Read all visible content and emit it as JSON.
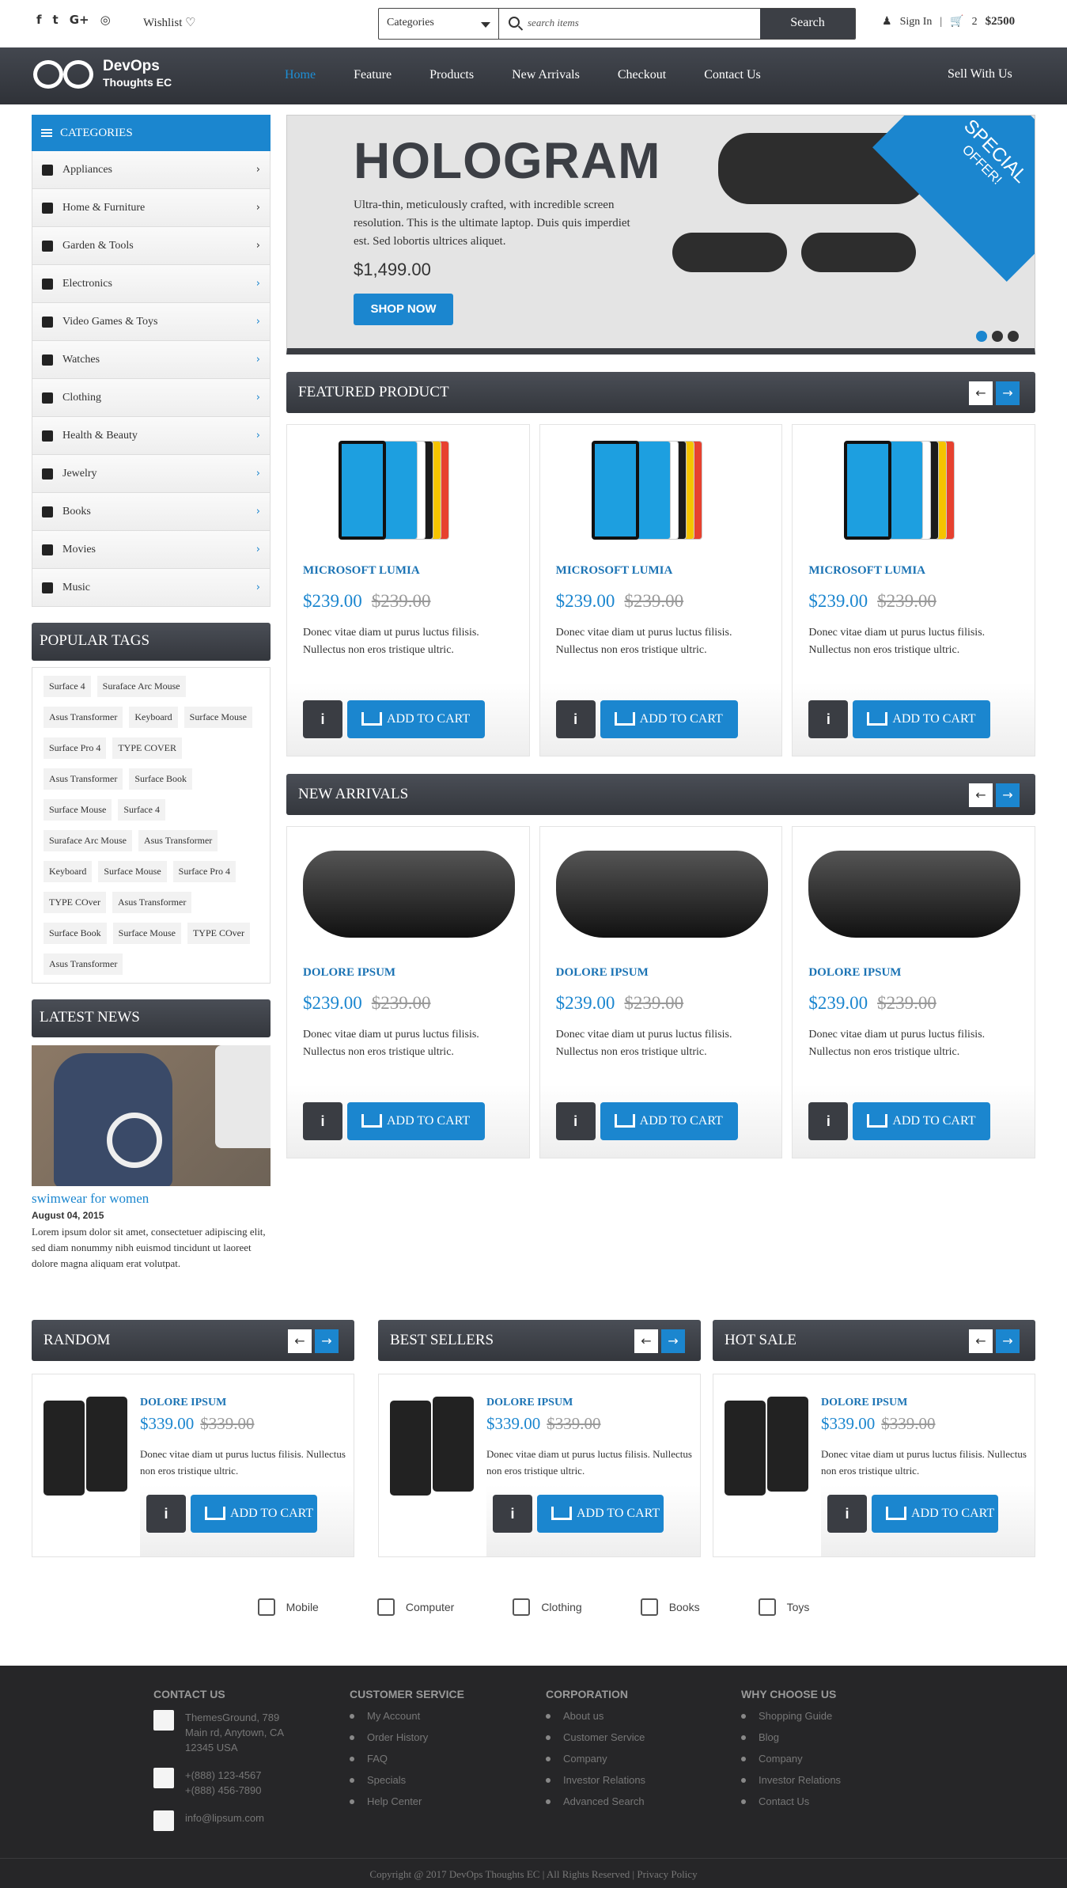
{
  "topbar": {
    "social_icons": [
      "facebook-icon",
      "twitter-icon",
      "google-plus-icon",
      "instagram-icon"
    ],
    "social_glyphs": [
      "f",
      "t",
      "G+",
      "◎"
    ],
    "wishlist": "Wishlist ♡",
    "search": {
      "category": "Categories",
      "placeholder": "search items",
      "button": "Search"
    },
    "sign_in": "Sign In",
    "cart_count": "2",
    "cart_total": "$2500"
  },
  "nav": {
    "logo_title": "DevOps",
    "logo_subtitle": "Thoughts EC",
    "links": [
      "Home",
      "Feature",
      "Products",
      "New Arrivals",
      "Checkout",
      "Contact Us"
    ],
    "sell": "Sell With Us"
  },
  "sidebar": {
    "categories_title": "CATEGORIES",
    "categories": [
      "Appliances",
      "Home & Furniture",
      "Garden & Tools",
      "Electronics",
      "Video Games & Toys",
      "Watches",
      "Clothing",
      "Health & Beauty",
      "Jewelry",
      "Books",
      "Movies",
      "Music"
    ],
    "popular_title": "POPULAR TAGS",
    "tags": [
      "Surface 4",
      "Suraface Arc Mouse",
      "Asus Transformer",
      "Keyboard",
      "Surface Mouse",
      "Surface Pro 4",
      "TYPE COVER",
      "Asus Transformer",
      "Surface Book",
      "Surface Mouse",
      "Surface 4",
      "Suraface Arc Mouse",
      "Asus Transformer",
      "Keyboard",
      "Surface Mouse",
      "Surface Pro 4",
      "TYPE COver",
      "Asus Transformer",
      "Surface Book",
      "Surface Mouse",
      "TYPE COver",
      "Asus Transformer"
    ],
    "news_title": "LATEST NEWS",
    "news": {
      "title": "swimwear for women",
      "date": "August 04, 2015",
      "text": "Lorem ipsum dolor sit amet, consectetuer adipiscing elit, sed diam nonummy nibh euismod tincidunt ut laoreet dolore magna aliquam erat volutpat."
    }
  },
  "hero": {
    "title": "HOLOGRAM",
    "text": "Ultra-thin, meticulously crafted, with incredible screen resolution. This is the ultimate laptop. Duis quis imperdiet est. Sed lobortis ultrices aliquet.",
    "price": "$1,499.00",
    "button": "SHOP NOW",
    "ribbon_main": "SPECIAL",
    "ribbon_sub": "OFFER!"
  },
  "featured": {
    "title": "FEATURED PRODUCT",
    "products": [
      {
        "name": "MICROSOFT LUMIA",
        "price": "$239.00",
        "old": "$239.00",
        "desc": "Donec vitae diam ut purus luctus filisis. Nullectus non eros tristique ultric."
      },
      {
        "name": "MICROSOFT LUMIA",
        "price": "$239.00",
        "old": "$239.00",
        "desc": "Donec vitae diam ut purus luctus filisis. Nullectus non eros tristique ultric."
      },
      {
        "name": "MICROSOFT LUMIA",
        "price": "$239.00",
        "old": "$239.00",
        "desc": "Donec vitae diam ut purus luctus filisis. Nullectus non eros tristique ultric."
      }
    ]
  },
  "arrivals": {
    "title": "NEW ARRIVALS",
    "products": [
      {
        "name": "DOLORE IPSUM",
        "price": "$239.00",
        "old": "$239.00",
        "desc": "Donec vitae diam ut purus luctus filisis. Nullectus non eros tristique ultric."
      },
      {
        "name": "DOLORE IPSUM",
        "price": "$239.00",
        "old": "$239.00",
        "desc": "Donec vitae diam ut purus luctus filisis. Nullectus non eros tristique ultric."
      },
      {
        "name": "DOLORE IPSUM",
        "price": "$239.00",
        "old": "$239.00",
        "desc": "Donec vitae diam ut purus luctus filisis. Nullectus non eros tristique ultric."
      }
    ]
  },
  "add_to_cart": "ADD TO CART",
  "info_glyph": "i",
  "arrow_left": "←",
  "arrow_right": "→",
  "mini_sections": [
    {
      "title": "RANDOM",
      "name": "DOLORE IPSUM",
      "price": "$339.00",
      "old": "$339.00",
      "desc": "Donec vitae diam ut purus luctus filisis. Nullectus non eros tristique ultric."
    },
    {
      "title": "BEST SELLERS",
      "name": "DOLORE IPSUM",
      "price": "$339.00",
      "old": "$339.00",
      "desc": "Donec vitae diam ut purus luctus filisis. Nullectus non eros tristique ultric."
    },
    {
      "title": "HOT SALE",
      "name": "DOLORE IPSUM",
      "price": "$339.00",
      "old": "$339.00",
      "desc": "Donec vitae diam ut purus luctus filisis. Nullectus non eros tristique ultric."
    }
  ],
  "bottom_categories": [
    "Mobile",
    "Computer",
    "Clothing",
    "Books",
    "Toys"
  ],
  "footer": {
    "contact_title": "CONTACT US",
    "address": "ThemesGround, 789 Main rd, Anytown, CA 12345 USA",
    "phone1": "+(888) 123-4567",
    "phone2": "+(888) 456-7890",
    "email": "info@lipsum.com",
    "service_title": "CUSTOMER SERVICE",
    "service": [
      "My Account",
      "Order History",
      "FAQ",
      "Specials",
      "Help Center"
    ],
    "corp_title": "CORPORATION",
    "corp": [
      "About us",
      "Customer Service",
      "Company",
      "Investor Relations",
      "Advanced Search"
    ],
    "why_title": "WHY CHOOSE US",
    "why": [
      "Shopping Guide",
      "Blog",
      "Company",
      "Investor Relations",
      "Contact Us"
    ],
    "copyright": "Copyright @ 2017 DevOps Thoughts EC | All Rights Reserved | Privacy Policy"
  },
  "colors": {
    "accent": "#1b86cf",
    "dark": "#3c3f45",
    "footer": "#262628"
  }
}
